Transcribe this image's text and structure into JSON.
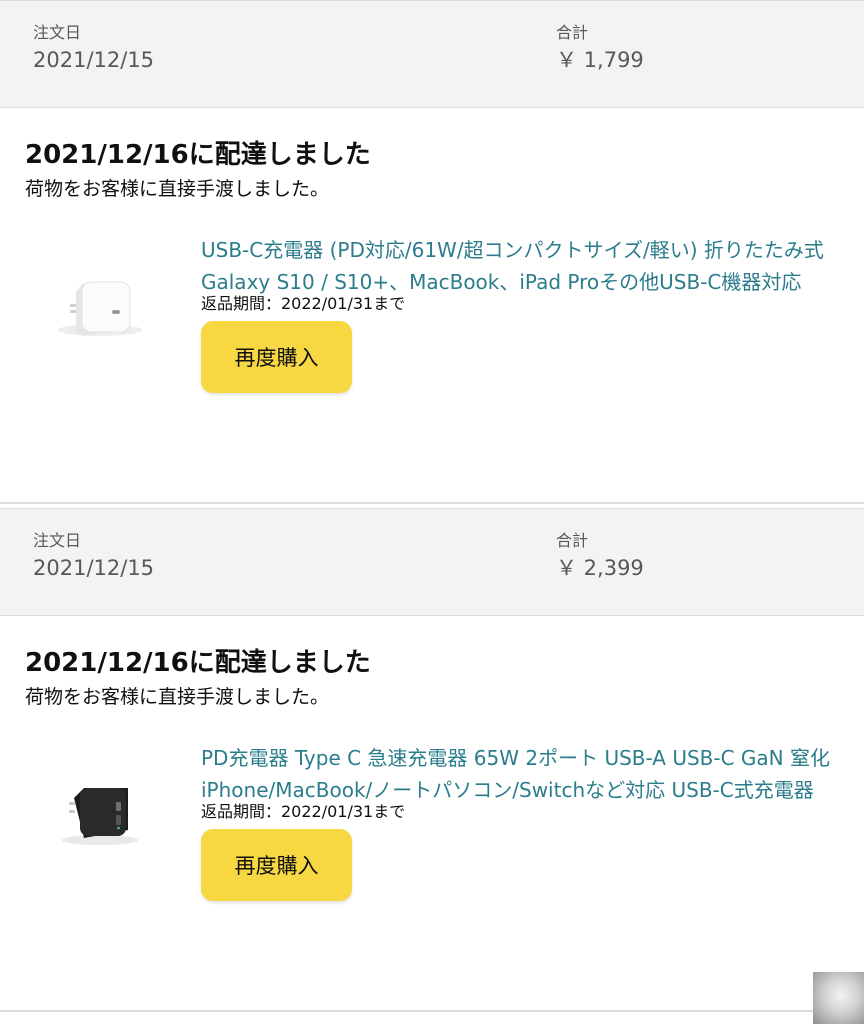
{
  "orders": [
    {
      "header": {
        "order_date_label": "注文日",
        "order_date": "2021/12/15",
        "total_label": "合計",
        "total": "￥ 1,799"
      },
      "shipment": {
        "status": "2021/12/16に配達しました",
        "detail": "荷物をお客様に直接手渡しました。",
        "product_image_icon": "white-usb-c-charger",
        "title_line1": "USB-C充電器 (PD対応/61W/超コンパクトサイズ/軽い) 折りたたみ式",
        "title_line2": "Galaxy S10 / S10+、MacBook、iPad Proその他USB-C機器対応",
        "return_window": "返品期間：2022/01/31まで",
        "rebuy_label": "再度購入"
      }
    },
    {
      "header": {
        "order_date_label": "注文日",
        "order_date": "2021/12/15",
        "total_label": "合計",
        "total": "￥ 2,399"
      },
      "shipment": {
        "status": "2021/12/16に配達しました",
        "detail": "荷物をお客様に直接手渡しました。",
        "product_image_icon": "black-gan-charger",
        "title_line1": "PD充電器 Type C 急速充電器 65W 2ポート USB-A USB-C GaN 窒化",
        "title_line2": "iPhone/MacBook/ノートパソコン/Switchなど対応 USB-C式充電器",
        "return_window": "返品期間：2022/01/31まで",
        "rebuy_label": "再度購入"
      }
    }
  ],
  "colors": {
    "header_bg": "#f3f3f3",
    "link": "#2c7d8c",
    "button": "#f7d842",
    "text": "#0f1111",
    "muted": "#565959"
  }
}
